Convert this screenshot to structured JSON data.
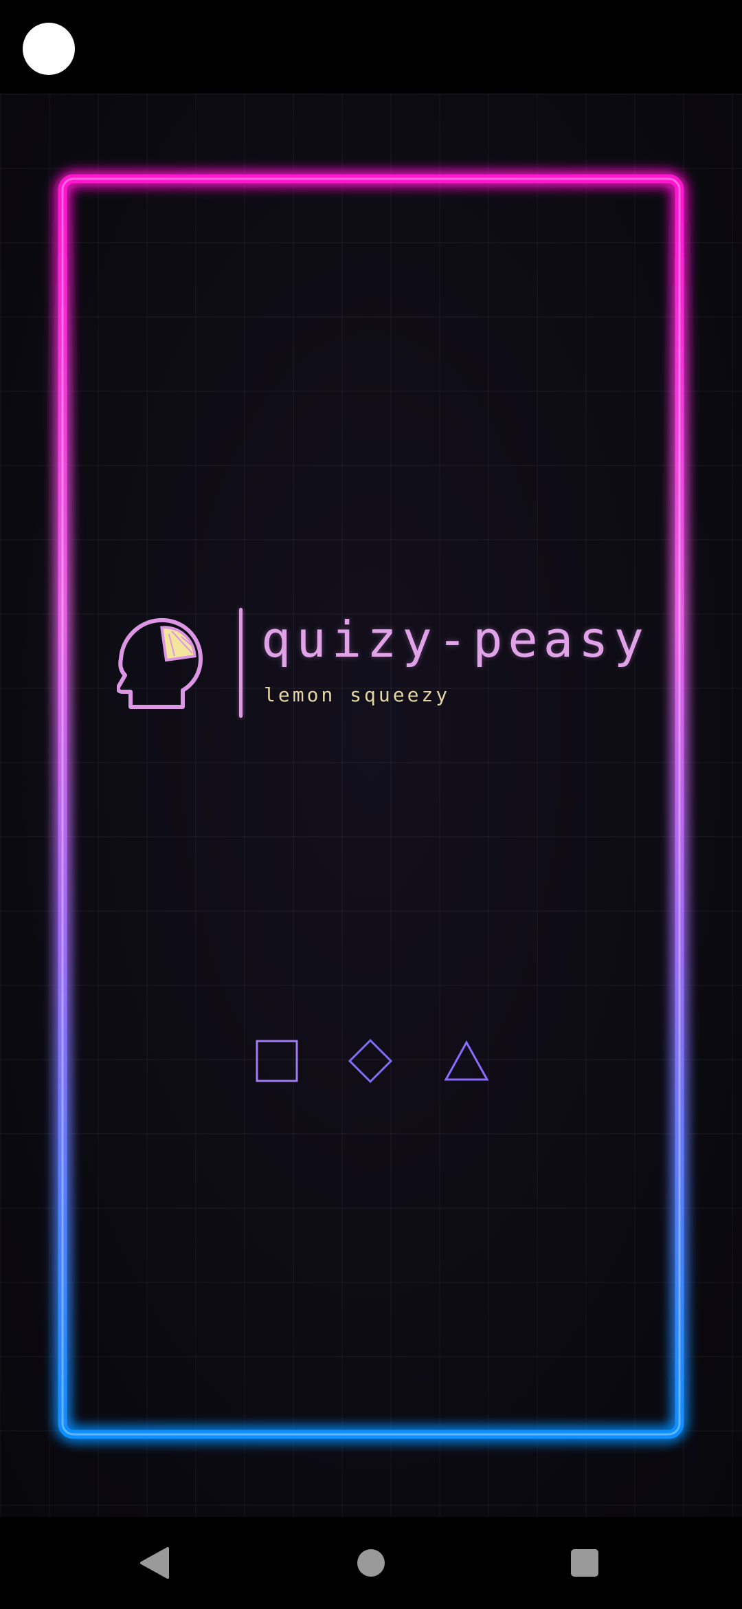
{
  "app": {
    "title": "quizy-peasy",
    "subtitle": "lemon squeezy"
  },
  "icons": {
    "logo": "head-with-lemon-icon",
    "shapes": [
      "square-icon",
      "diamond-icon",
      "triangle-icon"
    ],
    "nav": [
      "back-icon",
      "home-icon",
      "recents-icon"
    ]
  },
  "colors": {
    "frame_top": "#ff1ad9",
    "frame_bottom": "#1a8cff",
    "title": "#e1a3e8",
    "subtitle": "#e3d6a3",
    "shape_stroke": "#8b6bff"
  }
}
